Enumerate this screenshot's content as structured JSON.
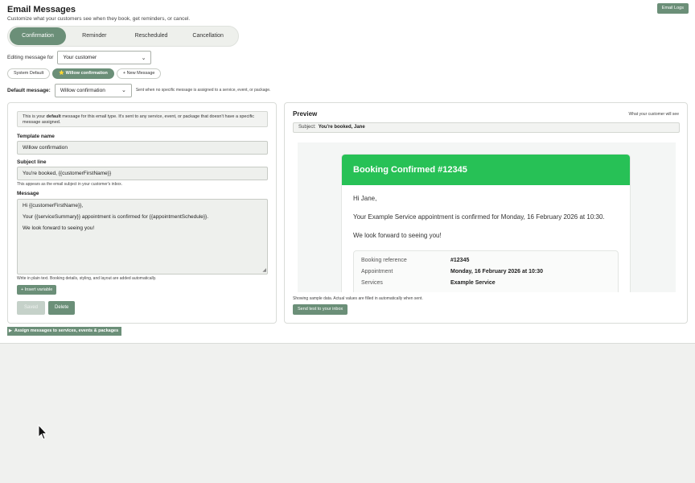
{
  "header": {
    "title": "Email Messages",
    "subtitle": "Customize what your customers see when they book, get reminders, or cancel.",
    "email_logs_label": "Email Logs"
  },
  "tabs": [
    {
      "label": "Confirmation",
      "active": true
    },
    {
      "label": "Reminder",
      "active": false
    },
    {
      "label": "Rescheduled",
      "active": false
    },
    {
      "label": "Cancellation",
      "active": false
    }
  ],
  "editing": {
    "label": "Editing message for",
    "selected": "Your customer"
  },
  "templates": {
    "system_default": "System Default",
    "willow": "⭐ Willow confirmation",
    "new_message": "+ New Message"
  },
  "default_message": {
    "label": "Default message:",
    "selected": "Willow confirmation",
    "hint": "Sent when no specific message is assigned to a service, event, or package."
  },
  "editor": {
    "info_prefix": "This is your ",
    "info_bold": "default",
    "info_suffix": " message for this email type. It's sent to any service, event, or package that doesn't have a specific message assigned.",
    "template_name_label": "Template name",
    "template_name_value": "Willow confirmation",
    "subject_label": "Subject line",
    "subject_value": "You're booked, {{customerFirstName}}",
    "subject_hint": "This appears as the email subject in your customer's inbox.",
    "message_label": "Message",
    "message_lines": [
      "Hi {{customerFirstName}},",
      "Your {{serviceSummary}} appointment is confirmed for {{appointmentSchedule}}.",
      "We look forward to seeing you!"
    ],
    "message_hint": "Write in plain text. Booking details, styling, and layout are added automatically.",
    "insert_variable_label": "+ Insert variable",
    "save_label": "Saved",
    "delete_label": "Delete"
  },
  "preview": {
    "title": "Preview",
    "hint": "What your customer will see",
    "subject_prefix": "Subject:",
    "subject_value": "You're booked, Jane",
    "email_heading": "Booking Confirmed #12345",
    "greeting": "Hi Jane,",
    "body_line": "Your Example Service appointment is confirmed for Monday, 16 February 2026 at 10:30.",
    "closing": "We look forward to seeing you!",
    "summary": [
      {
        "key": "Booking reference",
        "value": "#12345"
      },
      {
        "key": "Appointment",
        "value": "Monday, 16 February 2026 at 10:30"
      },
      {
        "key": "Services",
        "value": "Example Service"
      }
    ],
    "sample_hint": "Showing sample data. Actual values are filled in automatically when sent.",
    "send_test_label": "Send test to your inbox"
  },
  "assign": {
    "label": "Assign messages to services, events & packages"
  },
  "colors": {
    "accent": "#6b8f78",
    "email_header": "#27c156"
  }
}
